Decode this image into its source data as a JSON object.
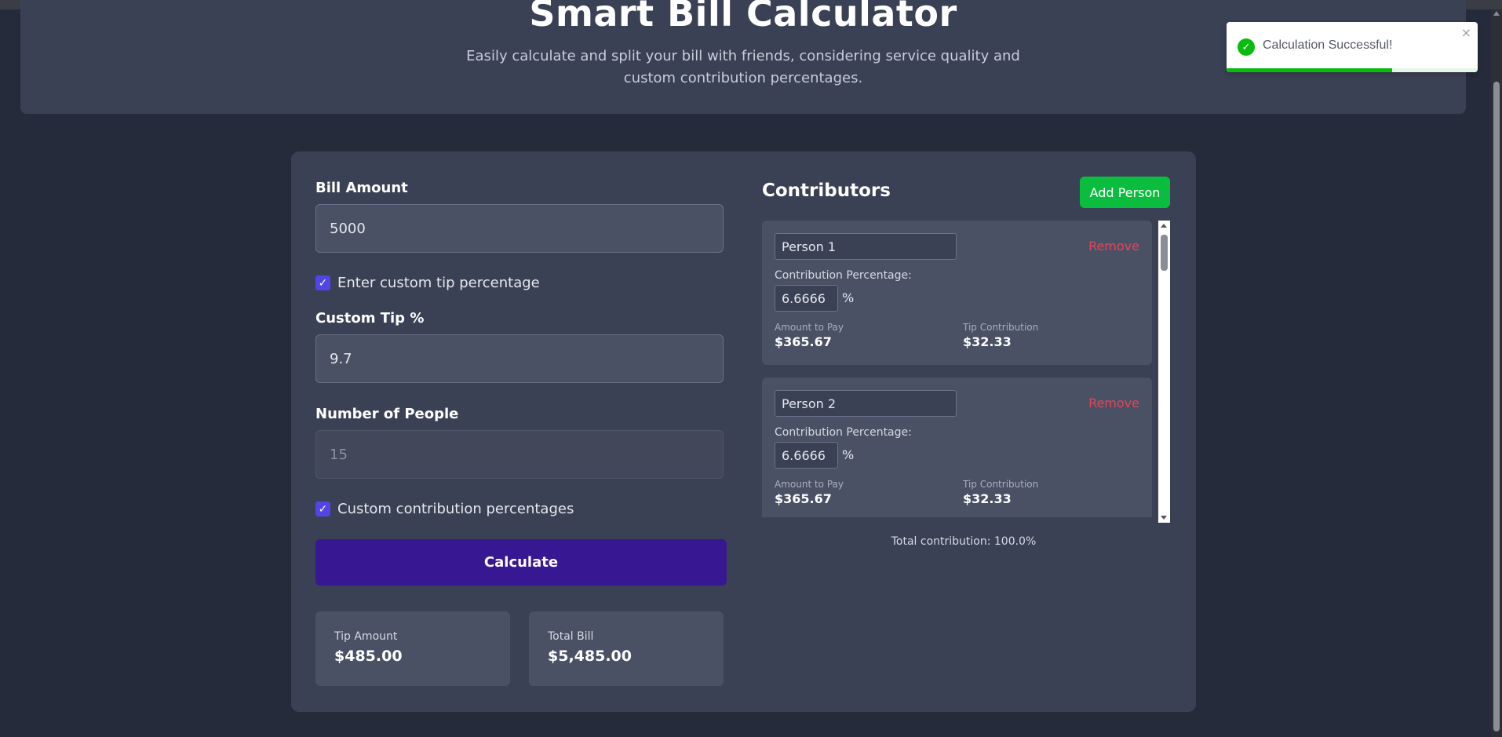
{
  "hero": {
    "title": "Smart Bill Calculator",
    "subtitle": "Easily calculate and split your bill with friends, considering service quality and custom contribution percentages."
  },
  "form": {
    "bill_label": "Bill Amount",
    "bill_value": "5000",
    "custom_tip_checkbox_label": "Enter custom tip percentage",
    "custom_tip_checked": true,
    "custom_tip_label": "Custom Tip %",
    "custom_tip_value": "9.7",
    "people_label": "Number of People",
    "people_value": "15",
    "custom_contrib_checkbox_label": "Custom contribution percentages",
    "custom_contrib_checked": true,
    "calculate_label": "Calculate"
  },
  "results": {
    "tip_label": "Tip Amount",
    "tip_value": "$485.00",
    "total_label": "Total Bill",
    "total_value": "$5,485.00"
  },
  "contributors": {
    "title": "Contributors",
    "add_label": "Add Person",
    "remove_label": "Remove",
    "contribution_label": "Contribution Percentage:",
    "percent_sign": "%",
    "amount_label": "Amount to Pay",
    "tip_contribution_label": "Tip Contribution",
    "people": [
      {
        "name": "Person 1",
        "percentage": "6.6666",
        "amount": "$365.67",
        "tip": "$32.33"
      },
      {
        "name": "Person 2",
        "percentage": "6.6666",
        "amount": "$365.67",
        "tip": "$32.33"
      }
    ],
    "total_text": "Total contribution: 100.0%"
  },
  "toast": {
    "message": "Calculation Successful!",
    "close_glyph": "×",
    "progress": 0.66
  },
  "colors": {
    "accent_button": "#371792",
    "add_button": "#0bbd3f",
    "remove_text": "#e0475b",
    "checkbox": "#4f46e5",
    "success": "#07bc0c"
  }
}
